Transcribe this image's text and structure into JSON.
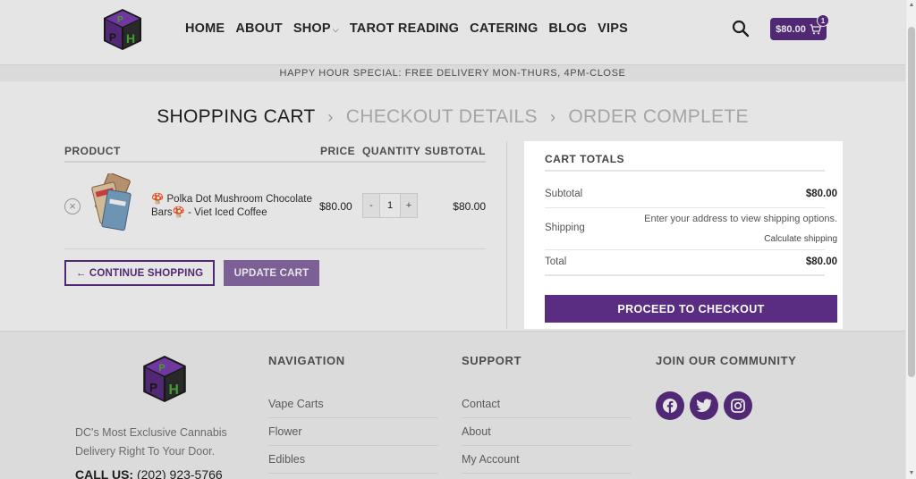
{
  "header": {
    "nav": [
      "HOME",
      "ABOUT",
      "SHOP",
      "TAROT READING",
      "CATERING",
      "BLOG",
      "VIPS"
    ],
    "cart_total": "$80.00",
    "cart_count": "1"
  },
  "topbar": {
    "text": "HAPPY HOUR SPECIAL: FREE DELIVERY MON-THURS, 4PM-CLOSE"
  },
  "steps": {
    "active": "SHOPPING CART",
    "step2": "CHECKOUT DETAILS",
    "step3": "ORDER COMPLETE",
    "separator": "›"
  },
  "cart": {
    "headers": {
      "product": "PRODUCT",
      "price": "PRICE",
      "quantity": "QUANTITY",
      "subtotal": "SUBTOTAL"
    },
    "item": {
      "name": "🍄 Polka Dot Mushroom Chocolate Bars🍄 - Viet Iced Coffee",
      "price": "$80.00",
      "quantity": "1",
      "subtotal": "$80.00"
    },
    "continue_label": "← CONTINUE SHOPPING",
    "update_label": "UPDATE CART"
  },
  "totals": {
    "title": "CART TOTALS",
    "subtotal_label": "Subtotal",
    "subtotal_value": "$80.00",
    "shipping_label": "Shipping",
    "shipping_note": "Enter your address to view shipping options.",
    "calc_shipping": "Calculate shipping",
    "total_label": "Total",
    "total_value": "$80.00",
    "checkout_label": "PROCEED TO CHECKOUT"
  },
  "footer": {
    "tagline": "DC's Most Exclusive Cannabis Delivery Right To Your Door.",
    "call_label": "CALL US:",
    "call_number": "(202) 923-5766",
    "navigation": {
      "heading": "NAVIGATION",
      "links": [
        "Vape Carts",
        "Flower",
        "Edibles"
      ]
    },
    "support": {
      "heading": "SUPPORT",
      "links": [
        "Contact",
        "About",
        "My Account"
      ]
    },
    "community": {
      "heading": "JOIN OUR COMMUNITY",
      "icons": [
        "facebook-icon",
        "twitter-icon",
        "instagram-icon"
      ]
    }
  },
  "colors": {
    "brand_purple": "#5a2d82",
    "update_purple": "#8a6aa6",
    "logo_green": "#4caf3a"
  }
}
